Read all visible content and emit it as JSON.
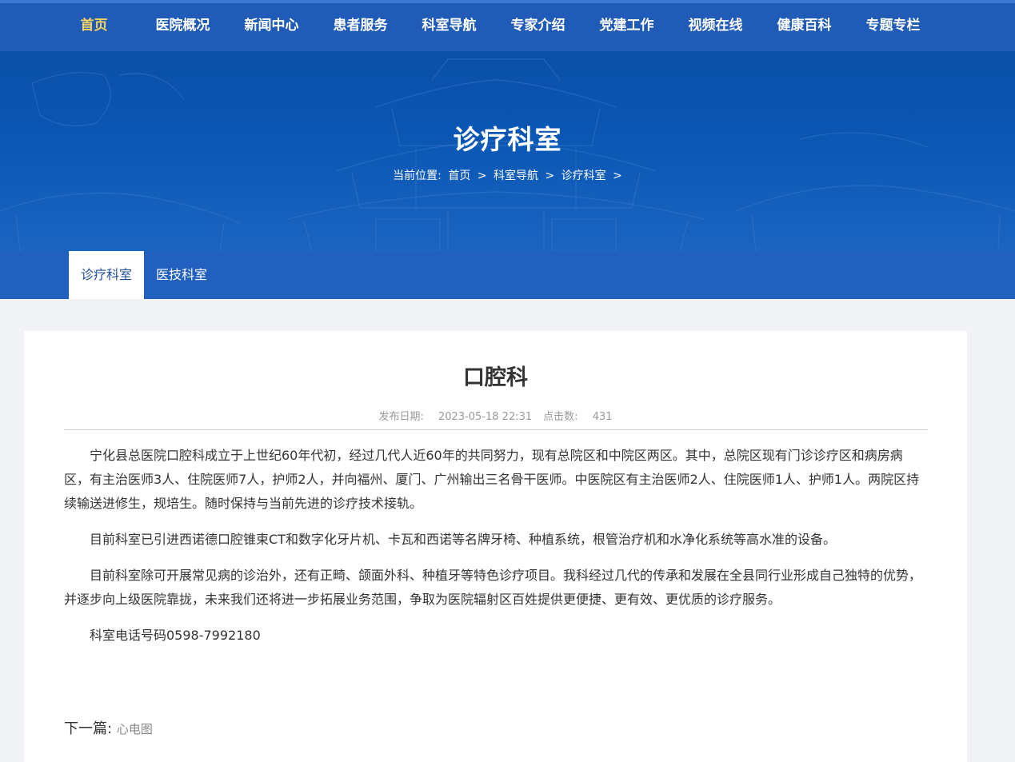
{
  "topnav": {
    "items": [
      "首页",
      "医院概况",
      "新闻中心",
      "患者服务",
      "科室导航",
      "专家介绍",
      "党建工作",
      "视频在线",
      "健康百科",
      "专题专栏"
    ],
    "active_index": 0,
    "active_color": "#f4d35e"
  },
  "banner": {
    "title": "诊疗科室",
    "breadcrumb": {
      "prefix": "当前位置:",
      "items": [
        "首页",
        "科室导航",
        "诊疗科室"
      ],
      "separator": ">"
    }
  },
  "subnav": {
    "tabs": [
      "诊疗科室",
      "医技科室"
    ],
    "active_index": 0
  },
  "article": {
    "title": "口腔科",
    "date_label": "发布日期:",
    "date": "2023-05-18 22:31",
    "clicks_label": "点击数:",
    "clicks": "431",
    "paragraphs": [
      "宁化县总医院口腔科成立于上世纪60年代初，经过几代人近60年的共同努力，现有总院区和中院区两区。其中，总院区现有门诊诊疗区和病房病区，有主治医师3人、住院医师7人，护师2人，并向福州、厦门、广州输出三名骨干医师。中医院区有主治医师2人、住院医师1人、护师1人。两院区持续输送进修生，规培生。随时保持与当前先进的诊疗技术接轨。",
      "目前科室已引进西诺德口腔锥束CT和数字化牙片机、卡瓦和西诺等名牌牙椅、种植系统，根管治疗机和水净化系统等高水准的设备。",
      "目前科室除可开展常见病的诊治外，还有正畸、颌面外科、种植牙等特色诊疗项目。我科经过几代的传承和发展在全县同行业形成自己独特的优势，并逐步向上级医院靠拢，未来我们还将进一步拓展业务范围，争取为医院辐射区百姓提供更便捷、更有效、更优质的诊疗服务。",
      "科室电话号码0598-7992180"
    ],
    "next_label": "下一篇:",
    "next_link": "心电图"
  },
  "colors": {
    "nav_bg": "#1f5bb7",
    "banner_bg": "#0b57b4",
    "subnav_bg": "#2160be"
  }
}
